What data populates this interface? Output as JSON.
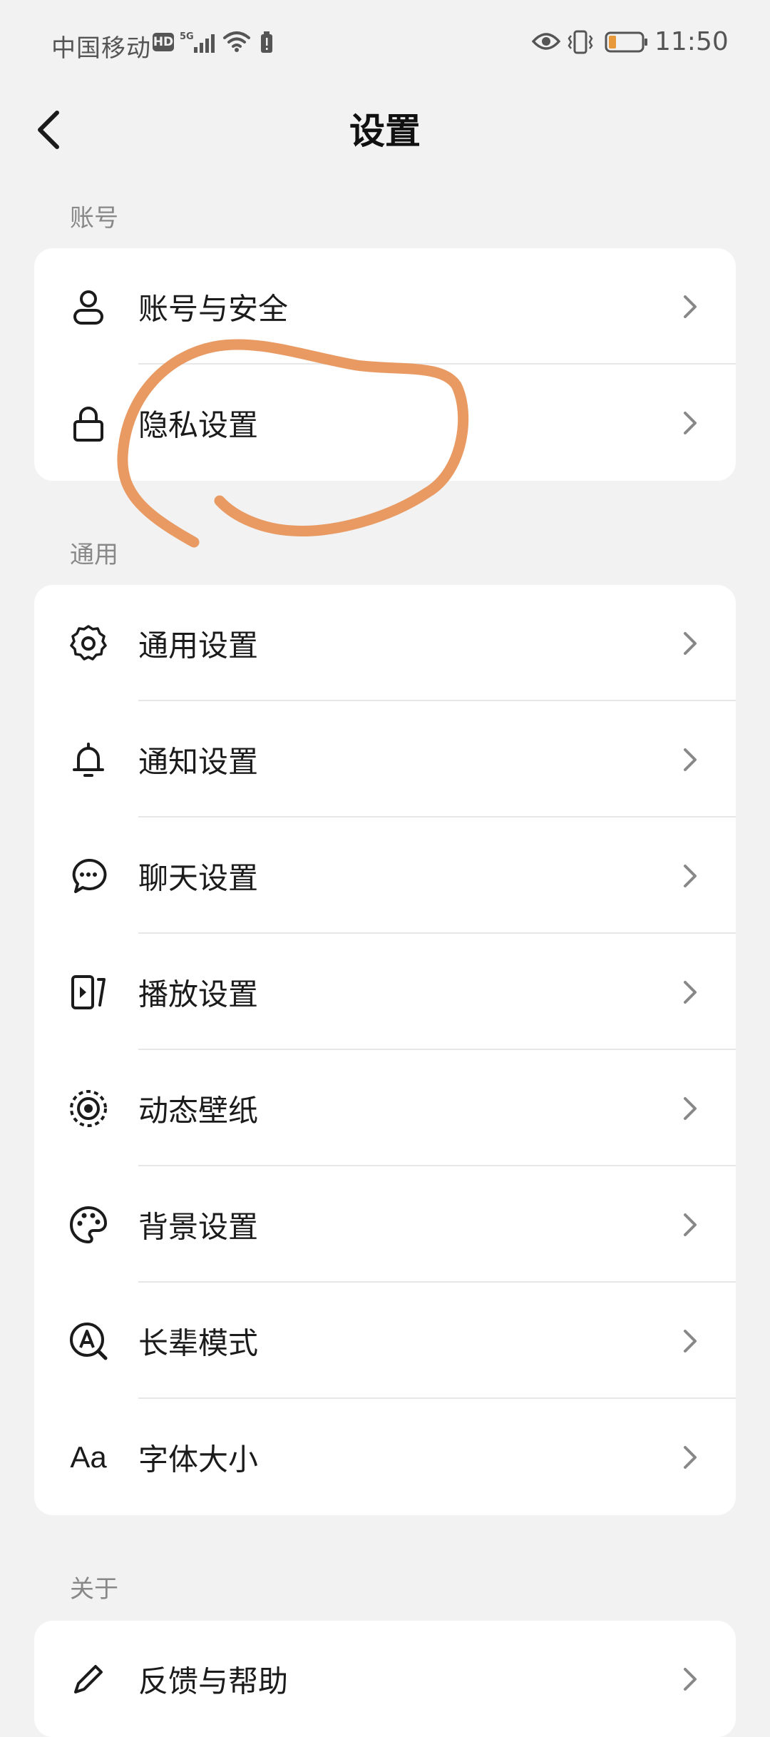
{
  "status_bar": {
    "carrier": "中国移动",
    "hd": "HD",
    "network": "5G",
    "time": "11:50"
  },
  "header": {
    "title": "设置"
  },
  "sections": [
    {
      "label": "账号",
      "items": [
        {
          "label": "账号与安全",
          "icon": "user-icon"
        },
        {
          "label": "隐私设置",
          "icon": "lock-icon"
        }
      ]
    },
    {
      "label": "通用",
      "items": [
        {
          "label": "通用设置",
          "icon": "gear-icon"
        },
        {
          "label": "通知设置",
          "icon": "bell-icon"
        },
        {
          "label": "聊天设置",
          "icon": "chat-bubble-icon"
        },
        {
          "label": "播放设置",
          "icon": "play-icon"
        },
        {
          "label": "动态壁纸",
          "icon": "live-wallpaper-icon"
        },
        {
          "label": "背景设置",
          "icon": "palette-icon"
        },
        {
          "label": "长辈模式",
          "icon": "elder-mode-icon"
        },
        {
          "label": "字体大小",
          "icon": "font-size-icon",
          "icon_text": "Aa"
        }
      ]
    },
    {
      "label": "关于",
      "items": [
        {
          "label": "反馈与帮助",
          "icon": "feedback-icon"
        }
      ]
    }
  ],
  "colors": {
    "background": "#f2f2f2",
    "card": "#ffffff",
    "annotation_stroke": "#e8955a"
  }
}
